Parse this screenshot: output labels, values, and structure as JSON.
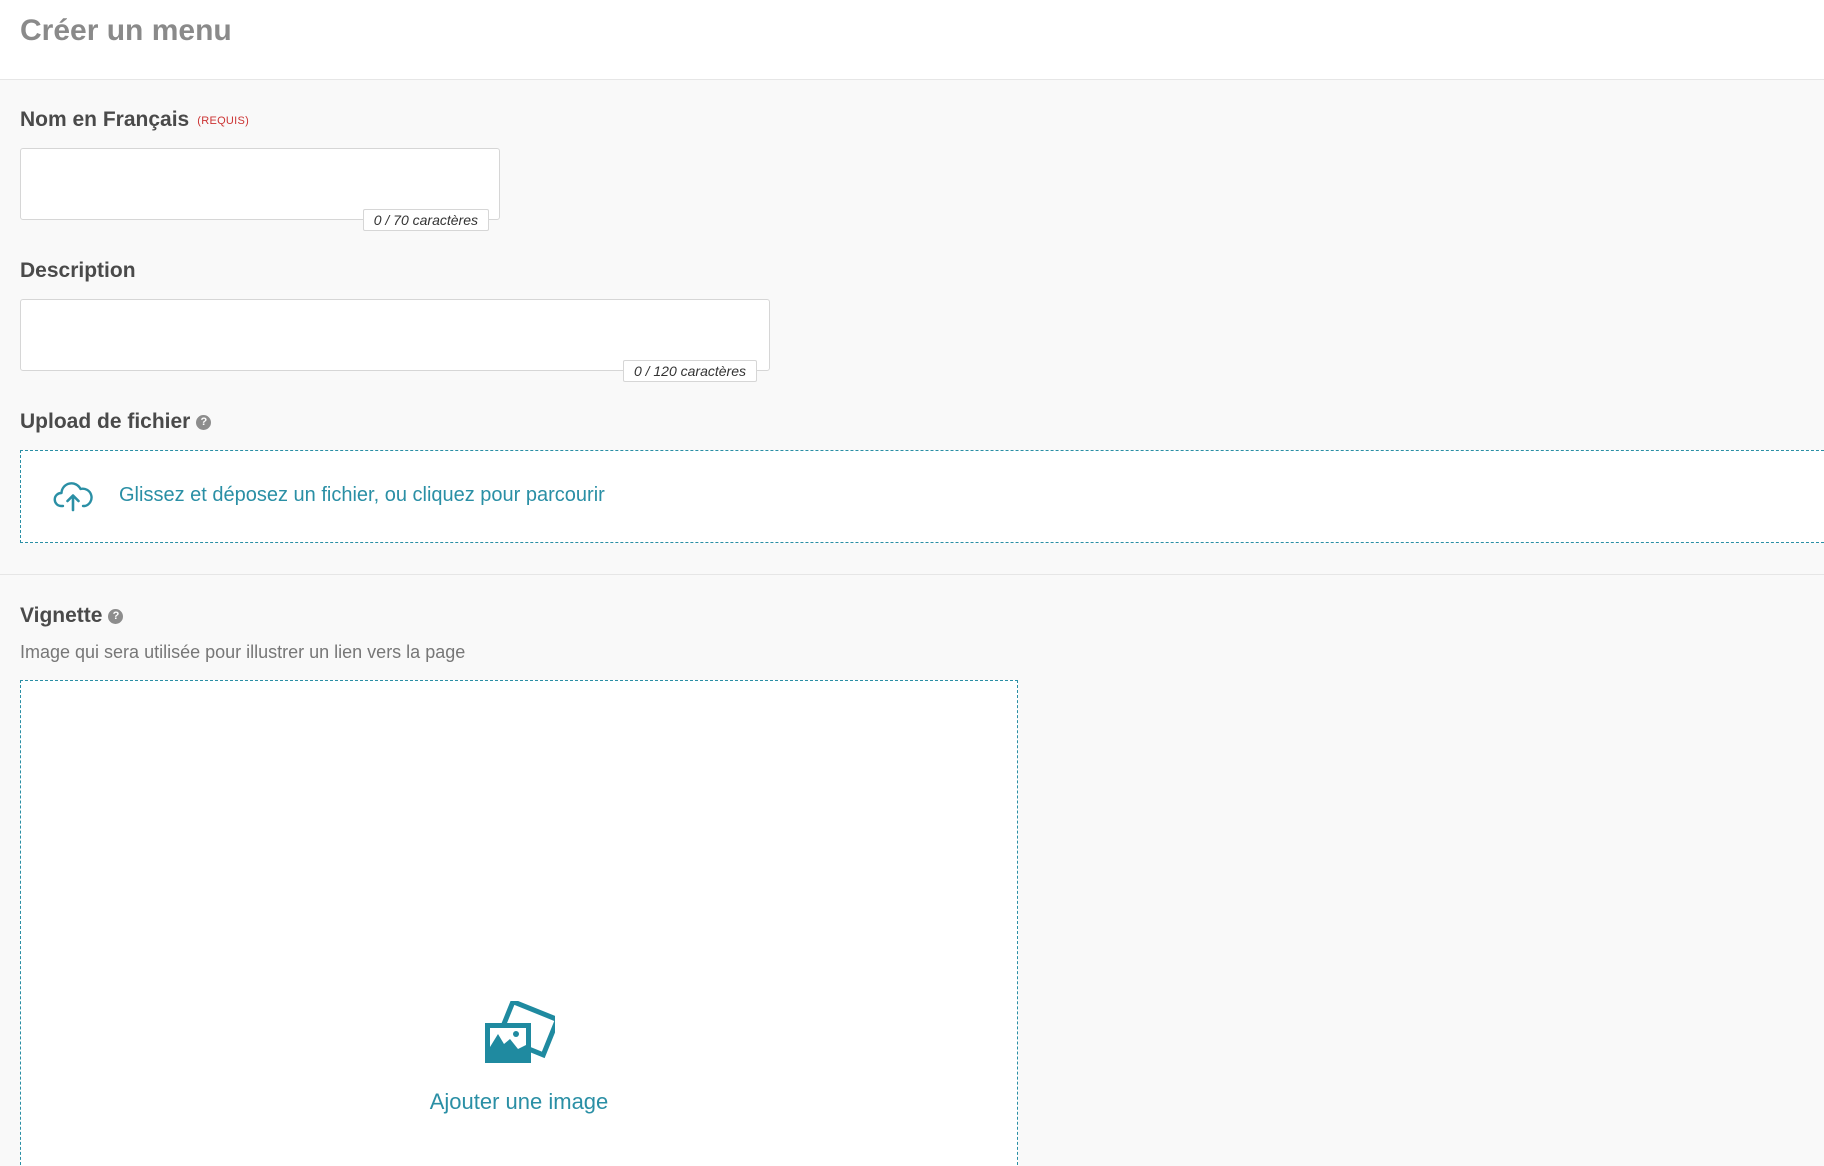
{
  "header": {
    "title": "Créer un menu"
  },
  "name_field": {
    "label": "Nom en Français",
    "required_tag": "(REQUIS)",
    "value": "",
    "counter": "0 / 70 caractères"
  },
  "description_field": {
    "label": "Description",
    "value": "",
    "counter": "0 / 120 caractères"
  },
  "file_upload": {
    "label": "Upload de fichier",
    "help_icon": "question-circle-icon",
    "dropzone_text": "Glissez et déposez un fichier, ou cliquez pour parcourir",
    "icon": "cloud-upload-icon"
  },
  "thumbnail": {
    "label": "Vignette",
    "help_icon": "question-circle-icon",
    "hint": "Image qui sera utilisée pour illustrer un lien vers la page",
    "add_image_text": "Ajouter une image",
    "icon": "image-icon"
  },
  "colors": {
    "accent": "#2a8fa5",
    "required": "#cc3333",
    "label": "#4a4a4a",
    "background": "#f9f9f9"
  }
}
